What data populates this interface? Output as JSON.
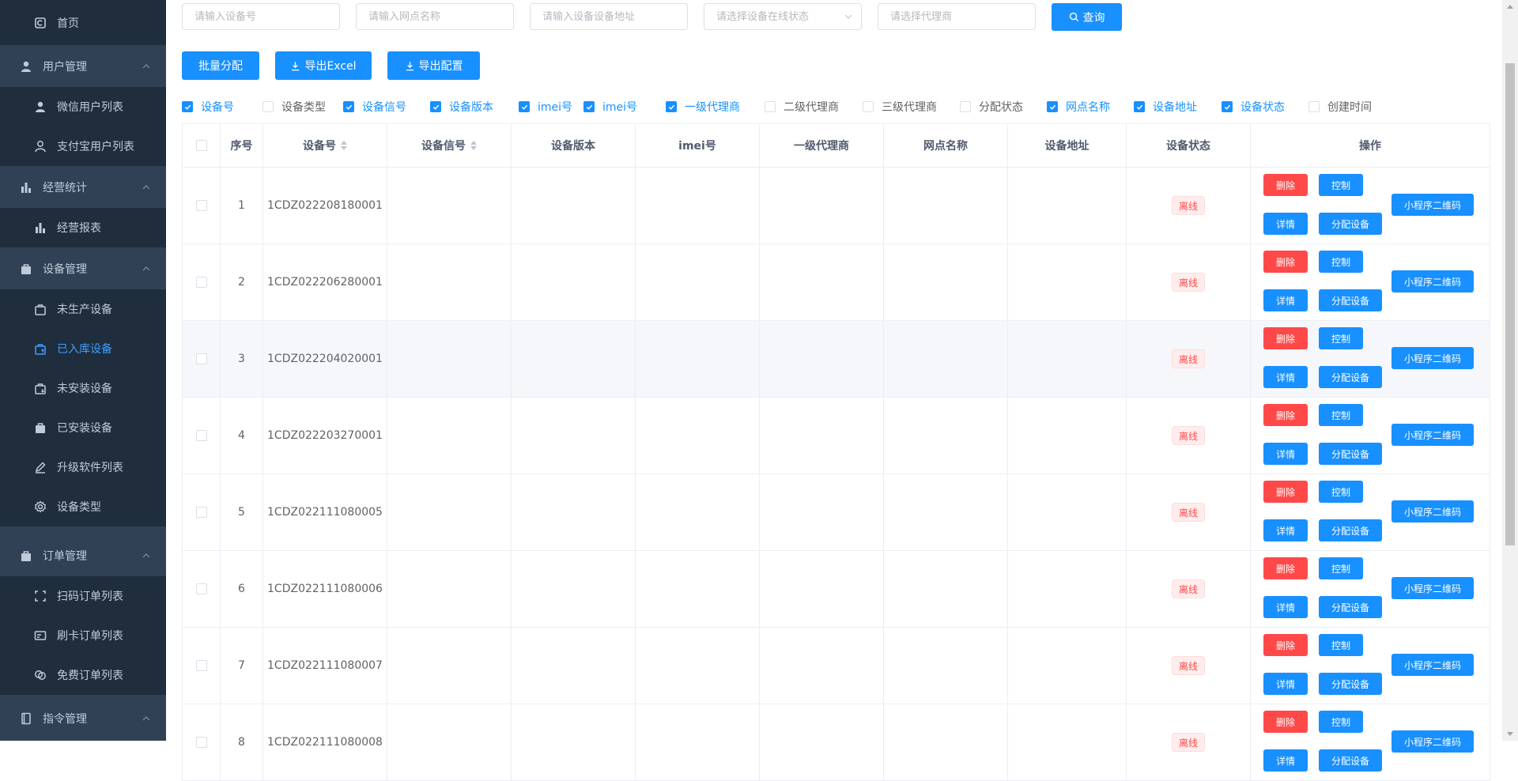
{
  "sidebar": {
    "home": "首页",
    "groups": [
      {
        "label": "用户管理",
        "icon": "user-icon",
        "items": [
          "微信用户列表",
          "支付宝用户列表"
        ]
      },
      {
        "label": "经营统计",
        "icon": "bar-chart-icon",
        "items": [
          "经营报表"
        ]
      },
      {
        "label": "设备管理",
        "icon": "briefcase-icon",
        "items": [
          "未生产设备",
          "已入库设备",
          "未安装设备",
          "已安装设备",
          "升级软件列表",
          "设备类型"
        ]
      },
      {
        "label": "订单管理",
        "icon": "briefcase-icon",
        "items": [
          "扫码订单列表",
          "刷卡订单列表",
          "免费订单列表"
        ]
      },
      {
        "label": "指令管理",
        "icon": "notebook-icon",
        "items": []
      }
    ],
    "active_item": "已入库设备"
  },
  "search": {
    "device_no_placeholder": "请输入设备号",
    "site_name_placeholder": "请输入网点名称",
    "address_placeholder": "请输入设备设备地址",
    "status_placeholder": "请选择设备在线状态",
    "agent_placeholder": "请选择代理商",
    "query_label": "查询"
  },
  "toolbar": {
    "batch_assign": "批量分配",
    "export_excel": "导出Excel",
    "export_config": "导出配置"
  },
  "columns_toggle": [
    {
      "label": "设备号",
      "checked": true
    },
    {
      "label": "设备类型",
      "checked": false
    },
    {
      "label": "设备信号",
      "checked": true
    },
    {
      "label": "设备版本",
      "checked": true
    },
    {
      "label": "imei号",
      "checked": true
    },
    {
      "label": "imei号",
      "checked": true
    },
    {
      "label": "一级代理商",
      "checked": true
    },
    {
      "label": "二级代理商",
      "checked": false
    },
    {
      "label": "三级代理商",
      "checked": false
    },
    {
      "label": "分配状态",
      "checked": false
    },
    {
      "label": "网点名称",
      "checked": true
    },
    {
      "label": "设备地址",
      "checked": true
    },
    {
      "label": "设备状态",
      "checked": true
    },
    {
      "label": "创建时间",
      "checked": false
    }
  ],
  "table": {
    "headers": {
      "index": "序号",
      "device_no": "设备号",
      "signal": "设备信号",
      "version": "设备版本",
      "imei": "imei号",
      "agent1": "一级代理商",
      "site": "网点名称",
      "address": "设备地址",
      "status": "设备状态",
      "ops": "操作"
    },
    "rows": [
      {
        "index": "1",
        "device_no": "1CDZ022208180001",
        "status": "离线"
      },
      {
        "index": "2",
        "device_no": "1CDZ022206280001",
        "status": "离线"
      },
      {
        "index": "3",
        "device_no": "1CDZ022204020001",
        "status": "离线"
      },
      {
        "index": "4",
        "device_no": "1CDZ022203270001",
        "status": "离线"
      },
      {
        "index": "5",
        "device_no": "1CDZ022111080005",
        "status": "离线"
      },
      {
        "index": "6",
        "device_no": "1CDZ022111080006",
        "status": "离线"
      },
      {
        "index": "7",
        "device_no": "1CDZ022111080007",
        "status": "离线"
      },
      {
        "index": "8",
        "device_no": "1CDZ022111080008",
        "status": "离线"
      }
    ],
    "ops": {
      "delete": "删除",
      "control": "控制",
      "detail": "详情",
      "assign": "分配设备",
      "qrcode": "小程序二维码"
    }
  },
  "colors": {
    "primary": "#1890ff",
    "danger": "#ff4949",
    "sidebar_bg": "#304156",
    "submenu_bg": "#1f2d3d",
    "active_menu": "#409eff"
  }
}
